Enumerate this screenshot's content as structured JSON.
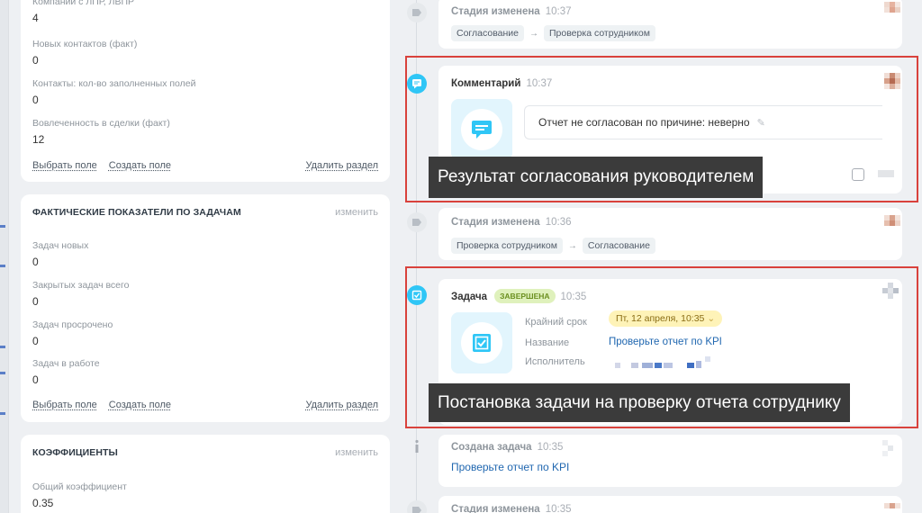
{
  "left_panel": {
    "card_main": {
      "fields": [
        {
          "label": "Компании с ЛПР, ЛВПР",
          "value": "4"
        },
        {
          "label": "Новых контактов (факт)",
          "value": "0"
        },
        {
          "label": "Контакты: кол-во заполненных полей",
          "value": "0"
        },
        {
          "label": "Вовлеченность в сделки (факт)",
          "value": "12"
        }
      ],
      "links": {
        "select": "Выбрать поле",
        "create": "Создать поле",
        "delete": "Удалить раздел"
      }
    },
    "card_tasks": {
      "title": "ФАКТИЧЕСКИЕ ПОКАЗАТЕЛИ ПО ЗАДАЧАМ",
      "change": "изменить",
      "fields": [
        {
          "label": "Задач новых",
          "value": "0"
        },
        {
          "label": "Закрытых задач всего",
          "value": "0"
        },
        {
          "label": "Задач просрочено",
          "value": "0"
        },
        {
          "label": "Задач в работе",
          "value": "0"
        }
      ],
      "links": {
        "select": "Выбрать поле",
        "create": "Создать поле",
        "delete": "Удалить раздел"
      }
    },
    "card_coef": {
      "title": "КОЭФФИЦИЕНТЫ",
      "change": "изменить",
      "fields": [
        {
          "label": "Общий коэффициент",
          "value": "0.35"
        }
      ]
    }
  },
  "timeline": {
    "stage1": {
      "title": "Стадия изменена",
      "time": "10:37",
      "from": "Согласование",
      "to": "Проверка сотрудником"
    },
    "comment": {
      "title": "Комментарий",
      "time": "10:37",
      "text": "Отчет не согласован по причине: неверно"
    },
    "stage2": {
      "title": "Стадия изменена",
      "time": "10:36",
      "from": "Проверка сотрудником",
      "to": "Согласование"
    },
    "task": {
      "title": "Задача",
      "badge": "ЗАВЕРШЕНА",
      "time": "10:35",
      "deadline_label": "Крайний срок",
      "deadline_value": "Пт, 12 апреля, 10:35",
      "name_label": "Название",
      "name_value": "Проверьте отчет по KPI",
      "assignee_label": "Исполнитель"
    },
    "created": {
      "title": "Создана задача",
      "time": "10:35",
      "link": "Проверьте отчет по KPI"
    },
    "stage3": {
      "title": "Стадия изменена",
      "time": "10:35"
    }
  },
  "overlays": {
    "comment_caption": "Результат согласования руководителем",
    "task_caption": "Постановка задачи на проверку отчета сотруднику"
  },
  "colors": {
    "accent_blue": "#2fc6f6",
    "highlight_red": "#d9423c",
    "link": "#2067b0"
  }
}
